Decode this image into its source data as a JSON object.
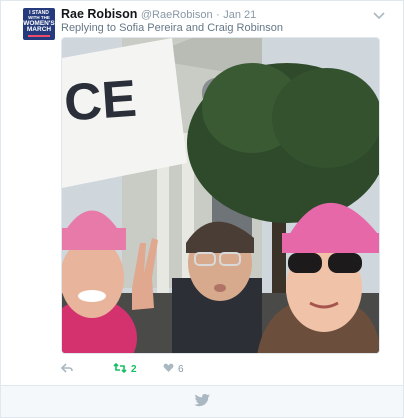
{
  "tweet": {
    "avatar": {
      "line1": "I STAND",
      "line2": "WITH THE",
      "line3": "WOMEN'S",
      "line4": "MARCH"
    },
    "author_name": "Rae Robison",
    "author_handle": "@RaeRobison",
    "separator": "·",
    "date": "Jan 21",
    "reply_prefix": "Replying to",
    "reply_user1": "Sofia Pereira",
    "reply_and": "and",
    "reply_user2": "Craig Robinson",
    "photo": {
      "sign_text": "CE"
    },
    "actions": {
      "reply_icon": "reply-icon",
      "retweet_icon": "retweet-icon",
      "retweet_count": "2",
      "like_icon": "heart-icon",
      "like_count": "6"
    }
  },
  "footer": {
    "icon": "twitter-bird-icon"
  },
  "colors": {
    "retweet_green": "#17bf63",
    "muted": "#8899a6",
    "avatar_blue": "#243a7c"
  }
}
